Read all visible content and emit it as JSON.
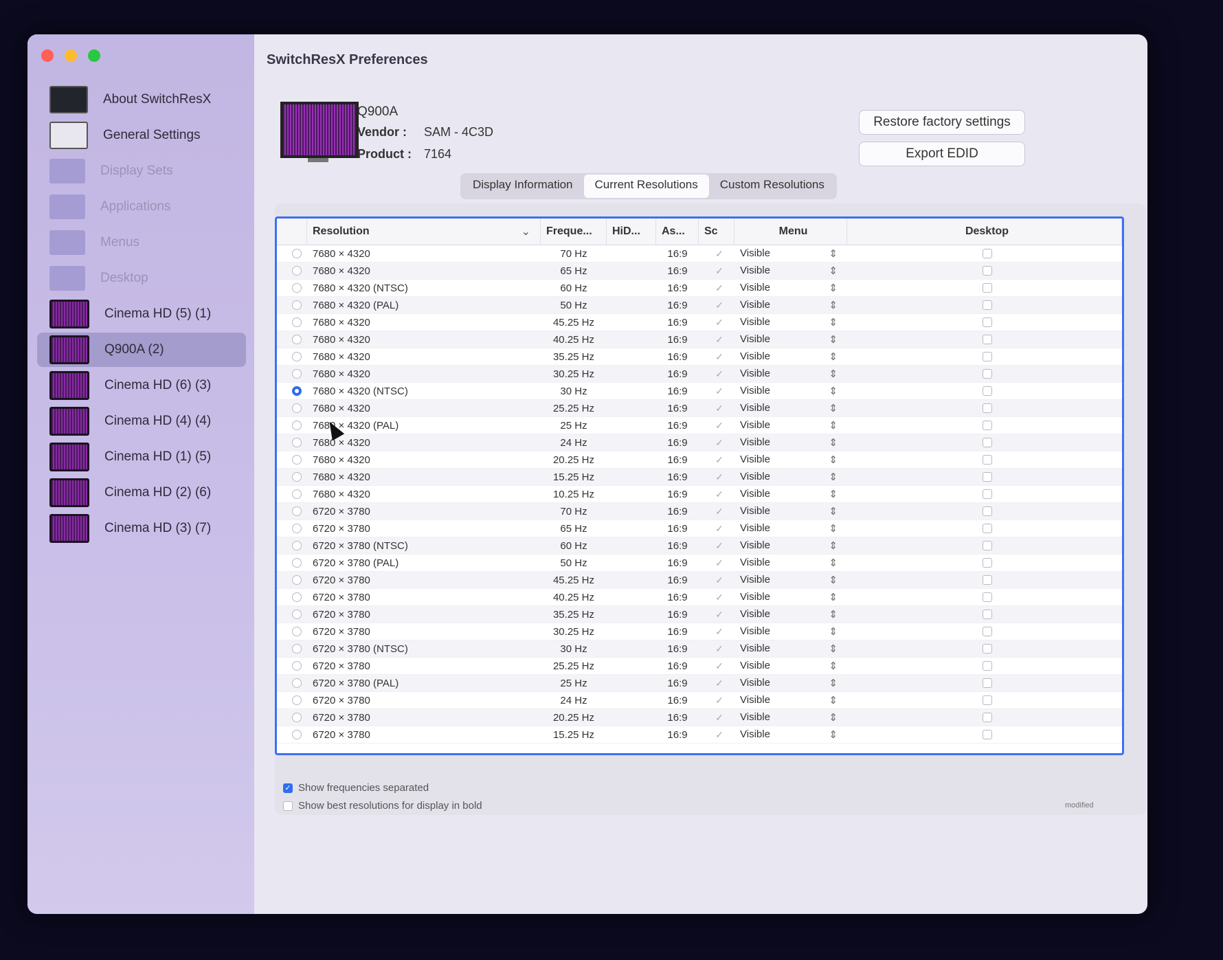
{
  "window": {
    "title": "SwitchResX Preferences"
  },
  "sidebar": {
    "items": [
      {
        "label": "About SwitchResX",
        "icon": "about-icon",
        "state": "normal"
      },
      {
        "label": "General Settings",
        "icon": "general-settings-icon",
        "state": "normal"
      },
      {
        "label": "Display Sets",
        "icon": "display-sets-icon",
        "state": "dim"
      },
      {
        "label": "Applications",
        "icon": "applications-icon",
        "state": "dim"
      },
      {
        "label": "Menus",
        "icon": "menus-icon",
        "state": "dim"
      },
      {
        "label": "Desktop",
        "icon": "desktop-icon",
        "state": "dim"
      },
      {
        "label": "Cinema HD (5) (1)",
        "icon": "monitor-icon",
        "state": "normal"
      },
      {
        "label": "Q900A (2)",
        "icon": "monitor-icon",
        "state": "selected"
      },
      {
        "label": "Cinema HD (6) (3)",
        "icon": "monitor-icon",
        "state": "normal"
      },
      {
        "label": "Cinema HD (4) (4)",
        "icon": "monitor-icon",
        "state": "normal"
      },
      {
        "label": "Cinema HD (1) (5)",
        "icon": "monitor-icon",
        "state": "normal"
      },
      {
        "label": "Cinema HD (2) (6)",
        "icon": "monitor-icon",
        "state": "normal"
      },
      {
        "label": "Cinema HD (3) (7)",
        "icon": "monitor-icon",
        "state": "normal"
      }
    ]
  },
  "display": {
    "name": "Q900A",
    "vendor_label": "Vendor :",
    "vendor": "SAM - 4C3D",
    "product_label": "Product :",
    "product": "7164"
  },
  "buttons": {
    "restore": "Restore factory settings",
    "export": "Export EDID"
  },
  "tabs": [
    {
      "label": "Display Information",
      "active": false
    },
    {
      "label": "Current Resolutions",
      "active": true
    },
    {
      "label": "Custom Resolutions",
      "active": false
    }
  ],
  "table": {
    "headers": {
      "resolution": "Resolution",
      "frequency": "Freque...",
      "hidpi": "HiD...",
      "aspect": "As...",
      "scale": "Sc",
      "menu": "Menu",
      "desktop": "Desktop"
    },
    "rows": [
      {
        "res": "7680 × 4320",
        "freq": "70 Hz",
        "aspect": "16:9",
        "menu": "Visible",
        "selected": false
      },
      {
        "res": "7680 × 4320",
        "freq": "65 Hz",
        "aspect": "16:9",
        "menu": "Visible",
        "selected": false
      },
      {
        "res": "7680 × 4320 (NTSC)",
        "freq": "60 Hz",
        "aspect": "16:9",
        "menu": "Visible",
        "selected": false
      },
      {
        "res": "7680 × 4320 (PAL)",
        "freq": "50 Hz",
        "aspect": "16:9",
        "menu": "Visible",
        "selected": false
      },
      {
        "res": "7680 × 4320",
        "freq": "45.25 Hz",
        "aspect": "16:9",
        "menu": "Visible",
        "selected": false
      },
      {
        "res": "7680 × 4320",
        "freq": "40.25 Hz",
        "aspect": "16:9",
        "menu": "Visible",
        "selected": false
      },
      {
        "res": "7680 × 4320",
        "freq": "35.25 Hz",
        "aspect": "16:9",
        "menu": "Visible",
        "selected": false
      },
      {
        "res": "7680 × 4320",
        "freq": "30.25 Hz",
        "aspect": "16:9",
        "menu": "Visible",
        "selected": false
      },
      {
        "res": "7680 × 4320 (NTSC)",
        "freq": "30 Hz",
        "aspect": "16:9",
        "menu": "Visible",
        "selected": true
      },
      {
        "res": "7680 × 4320",
        "freq": "25.25 Hz",
        "aspect": "16:9",
        "menu": "Visible",
        "selected": false
      },
      {
        "res": "7680 × 4320 (PAL)",
        "freq": "25 Hz",
        "aspect": "16:9",
        "menu": "Visible",
        "selected": false
      },
      {
        "res": "7680 × 4320",
        "freq": "24 Hz",
        "aspect": "16:9",
        "menu": "Visible",
        "selected": false
      },
      {
        "res": "7680 × 4320",
        "freq": "20.25 Hz",
        "aspect": "16:9",
        "menu": "Visible",
        "selected": false
      },
      {
        "res": "7680 × 4320",
        "freq": "15.25 Hz",
        "aspect": "16:9",
        "menu": "Visible",
        "selected": false
      },
      {
        "res": "7680 × 4320",
        "freq": "10.25 Hz",
        "aspect": "16:9",
        "menu": "Visible",
        "selected": false
      },
      {
        "res": "6720 × 3780",
        "freq": "70 Hz",
        "aspect": "16:9",
        "menu": "Visible",
        "selected": false
      },
      {
        "res": "6720 × 3780",
        "freq": "65 Hz",
        "aspect": "16:9",
        "menu": "Visible",
        "selected": false
      },
      {
        "res": "6720 × 3780 (NTSC)",
        "freq": "60 Hz",
        "aspect": "16:9",
        "menu": "Visible",
        "selected": false
      },
      {
        "res": "6720 × 3780 (PAL)",
        "freq": "50 Hz",
        "aspect": "16:9",
        "menu": "Visible",
        "selected": false
      },
      {
        "res": "6720 × 3780",
        "freq": "45.25 Hz",
        "aspect": "16:9",
        "menu": "Visible",
        "selected": false
      },
      {
        "res": "6720 × 3780",
        "freq": "40.25 Hz",
        "aspect": "16:9",
        "menu": "Visible",
        "selected": false
      },
      {
        "res": "6720 × 3780",
        "freq": "35.25 Hz",
        "aspect": "16:9",
        "menu": "Visible",
        "selected": false
      },
      {
        "res": "6720 × 3780",
        "freq": "30.25 Hz",
        "aspect": "16:9",
        "menu": "Visible",
        "selected": false
      },
      {
        "res": "6720 × 3780 (NTSC)",
        "freq": "30 Hz",
        "aspect": "16:9",
        "menu": "Visible",
        "selected": false
      },
      {
        "res": "6720 × 3780",
        "freq": "25.25 Hz",
        "aspect": "16:9",
        "menu": "Visible",
        "selected": false
      },
      {
        "res": "6720 × 3780 (PAL)",
        "freq": "25 Hz",
        "aspect": "16:9",
        "menu": "Visible",
        "selected": false
      },
      {
        "res": "6720 × 3780",
        "freq": "24 Hz",
        "aspect": "16:9",
        "menu": "Visible",
        "selected": false
      },
      {
        "res": "6720 × 3780",
        "freq": "20.25 Hz",
        "aspect": "16:9",
        "menu": "Visible",
        "selected": false
      },
      {
        "res": "6720 × 3780",
        "freq": "15.25 Hz",
        "aspect": "16:9",
        "menu": "Visible",
        "selected": false
      }
    ]
  },
  "options": {
    "show_freq": {
      "label": "Show frequencies separated",
      "checked": true
    },
    "show_best": {
      "label": "Show best resolutions for display in bold",
      "checked": false
    }
  },
  "status": {
    "modified": "modified"
  },
  "colors": {
    "accent": "#2f6df0",
    "sidebar": "#c2b6e2",
    "selected_sidebar": "#a49ccc"
  }
}
